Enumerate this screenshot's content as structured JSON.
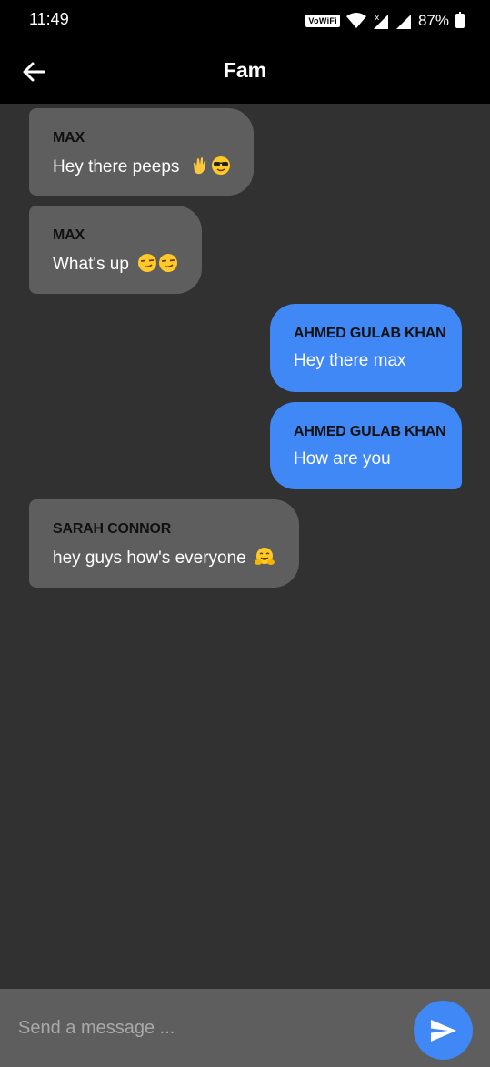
{
  "status_bar": {
    "time": "11:49",
    "vowifi": "VoWiFi",
    "battery": "87%"
  },
  "header": {
    "title": "Fam"
  },
  "messages": [
    {
      "sender": "MAX",
      "text": "Hey there peeps",
      "emojis": [
        "waving-hand",
        "sunglasses-face"
      ],
      "direction": "received"
    },
    {
      "sender": "MAX",
      "text": "What's up",
      "emojis": [
        "smirk-face",
        "smirk-face"
      ],
      "direction": "received"
    },
    {
      "sender": "AHMED GULAB KHAN",
      "text": "Hey there max",
      "emojis": [],
      "direction": "sent"
    },
    {
      "sender": "AHMED GULAB KHAN",
      "text": "How are you",
      "emojis": [],
      "direction": "sent"
    },
    {
      "sender": "SARAH CONNOR",
      "text": "hey guys how's everyone",
      "emojis": [
        "hugging-face"
      ],
      "direction": "received"
    }
  ],
  "composer": {
    "placeholder": "Send a message ...",
    "value": ""
  },
  "colors": {
    "background": "#313131",
    "received_bubble": "#5e5e5e",
    "sent_bubble": "#3f88f6",
    "header": "#000000"
  }
}
